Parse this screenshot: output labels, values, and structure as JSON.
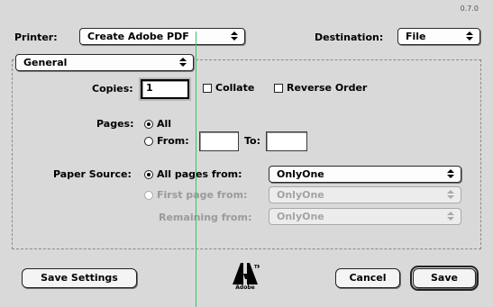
{
  "version": "0.7.0",
  "printer": {
    "label": "Printer:",
    "value": "Create Adobe PDF"
  },
  "destination": {
    "label": "Destination:",
    "value": "File"
  },
  "panel_popup": {
    "value": "General"
  },
  "copies": {
    "label": "Copies:",
    "value": "1"
  },
  "collate": {
    "label": "Collate",
    "checked": false
  },
  "reverse_order": {
    "label": "Reverse Order",
    "checked": false
  },
  "pages": {
    "label": "Pages:",
    "all_label": "All",
    "from_label": "From:",
    "to_label": "To:",
    "from_value": "",
    "to_value": "",
    "selected": "all"
  },
  "paper_source": {
    "label": "Paper Source:",
    "all_pages_label": "All pages from:",
    "all_pages_value": "OnlyOne",
    "first_page_label": "First page from:",
    "first_page_value": "OnlyOne",
    "remaining_label": "Remaining from:",
    "remaining_value": "OnlyOne",
    "selected": "all_pages"
  },
  "buttons": {
    "save_settings": "Save Settings",
    "cancel": "Cancel",
    "save": "Save"
  },
  "logo": {
    "text": "Adobe"
  },
  "colors": {
    "background": "#d9d9d9",
    "guide_line": "#3fbf6a"
  }
}
